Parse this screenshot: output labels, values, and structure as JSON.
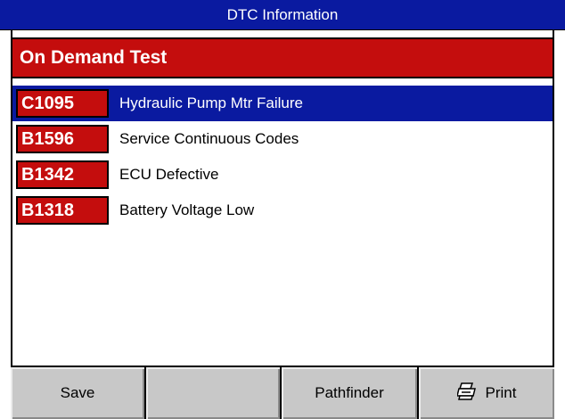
{
  "window": {
    "title": "DTC Information"
  },
  "section": {
    "title": "On Demand Test"
  },
  "dtc_codes": [
    {
      "code": "C1095",
      "description": "Hydraulic Pump Mtr Failure",
      "selected": true
    },
    {
      "code": "B1596",
      "description": "Service Continuous Codes",
      "selected": false
    },
    {
      "code": "B1342",
      "description": "ECU Defective",
      "selected": false
    },
    {
      "code": "B1318",
      "description": "Battery Voltage Low",
      "selected": false
    }
  ],
  "toolbar": {
    "save_label": "Save",
    "blank_label": "",
    "pathfinder_label": "Pathfinder",
    "print_label": "Print",
    "print_icon": "printer-icon"
  },
  "colors": {
    "title_bar": "#0a1aa0",
    "header_red": "#c40d0d",
    "selection": "#0a1aa0",
    "button_gray": "#c8c8c8"
  }
}
